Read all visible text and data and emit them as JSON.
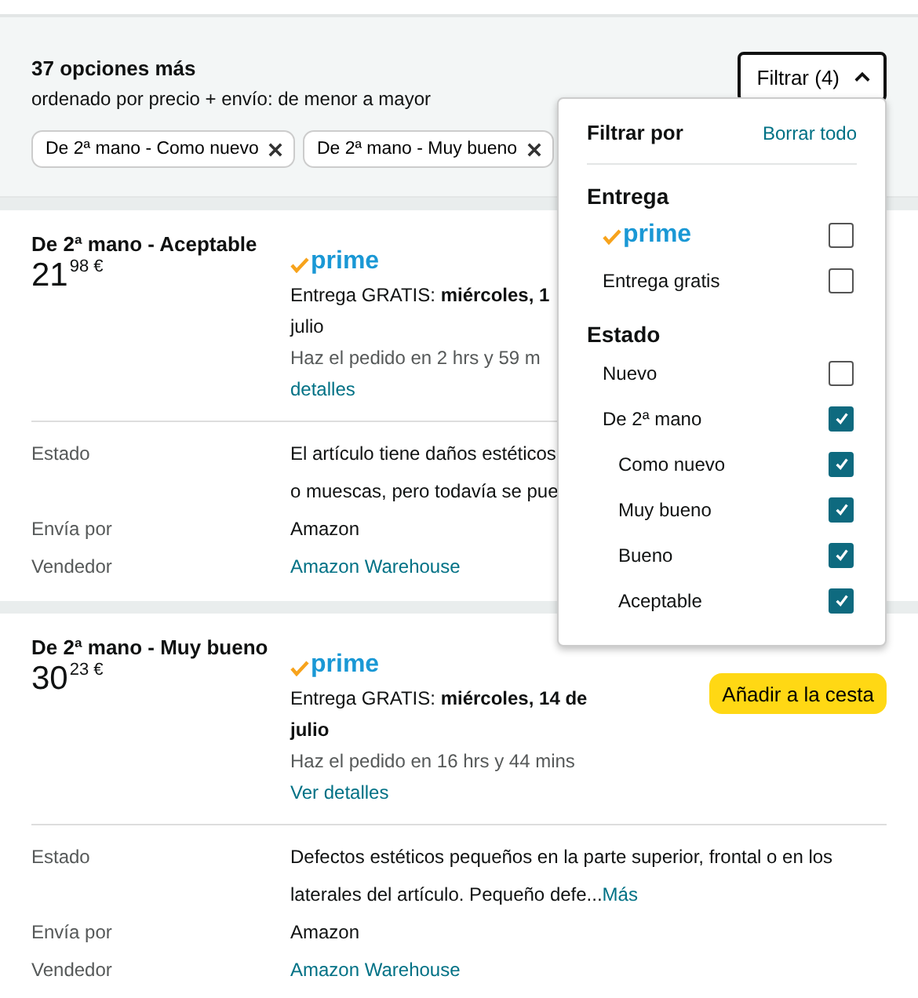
{
  "header": {
    "count": "37 opciones más",
    "sort": "ordenado por precio + envío: de menor a mayor",
    "filter_button": "Filtrar (4)",
    "expanded": true,
    "chips": [
      {
        "label": "De 2ª mano - Como nuevo",
        "removable": true
      },
      {
        "label": "De 2ª mano - Muy bueno",
        "removable": true
      }
    ]
  },
  "offers": [
    {
      "condition_title": "De 2ª mano - Aceptable",
      "price_whole": "21",
      "price_fraction": "98",
      "currency": "€",
      "prime": "prime",
      "delivery": "Entrega GRATIS: **miércoles, 1**\njulio",
      "order_by": "Haz el pedido en 2 hrs y 59 m",
      "details_link": "detalles",
      "details": [
        {
          "label": "Estado",
          "value": "El artículo tiene daños estéticos\no muescas, pero todavía se pue",
          "kind": "text"
        },
        {
          "label": "Envía por",
          "value": "Amazon",
          "kind": "text"
        },
        {
          "label": "Vendedor",
          "value": "Amazon Warehouse",
          "kind": "link"
        }
      ]
    },
    {
      "condition_title": "De 2ª mano - Muy bueno",
      "price_whole": "30",
      "price_fraction": "23",
      "currency": "€",
      "prime": "prime",
      "delivery": "Entrega GRATIS: **miércoles, 14 de\njulio**",
      "order_by": "Haz el pedido en 16 hrs y 44 mins",
      "details_link": "Ver detalles",
      "cart_button": "Añadir a la cesta",
      "details": [
        {
          "label": "Estado",
          "value": "Defectos estéticos pequeños en la parte superior, frontal o en los laterales del artículo. Pequeño defe...",
          "more": "Más",
          "kind": "text"
        },
        {
          "label": "Envía por",
          "value": "Amazon",
          "kind": "text"
        },
        {
          "label": "Vendedor",
          "value": "Amazon Warehouse",
          "kind": "link"
        }
      ]
    }
  ],
  "filter_panel": {
    "title": "Filtrar por",
    "clear": "Borrar todo",
    "sections": [
      {
        "title": "Entrega",
        "options": [
          {
            "kind": "prime",
            "label": "prime",
            "checked": false
          },
          {
            "kind": "text",
            "label": "Entrega gratis",
            "checked": false
          }
        ]
      },
      {
        "title": "Estado",
        "options": [
          {
            "kind": "text",
            "label": "Nuevo",
            "checked": false
          },
          {
            "kind": "text",
            "label": "De 2ª mano",
            "checked": true,
            "children": [
              {
                "kind": "text",
                "label": "Como nuevo",
                "checked": true
              },
              {
                "kind": "text",
                "label": "Muy bueno",
                "checked": true
              },
              {
                "kind": "text",
                "label": "Bueno",
                "checked": true
              },
              {
                "kind": "text",
                "label": "Aceptable",
                "checked": true
              }
            ]
          }
        ]
      }
    ]
  }
}
